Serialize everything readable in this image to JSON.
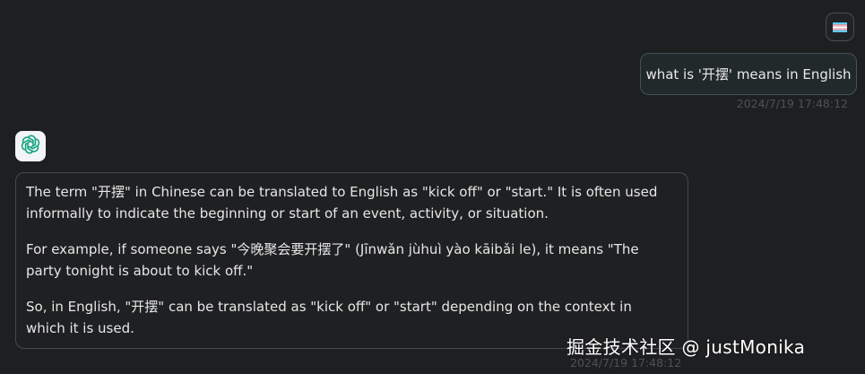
{
  "user_message": {
    "avatar_icon": "pride-flag-icon",
    "text": "what is '开摆' means in English",
    "timestamp": "2024/7/19 17:48:12"
  },
  "assistant_message": {
    "avatar_icon": "openai-logo-icon",
    "avatar_color": "#10a37f",
    "paragraphs": [
      "The term \"开摆\" in Chinese can be translated to English as \"kick off\" or \"start.\" It is often used informally to indicate the beginning or start of an event, activity, or situation.",
      "For example, if someone says \"今晚聚会要开摆了\" (Jīnwǎn jùhuì yào kāibǎi le), it means \"The party tonight is about to kick off.\"",
      "So, in English, \"开摆\" can be translated as \"kick off\" or \"start\" depending on the context in which it is used."
    ],
    "timestamp": "2024/7/19 17:48:12"
  },
  "watermark": {
    "text": "掘金技术社区 @ justMonika"
  }
}
